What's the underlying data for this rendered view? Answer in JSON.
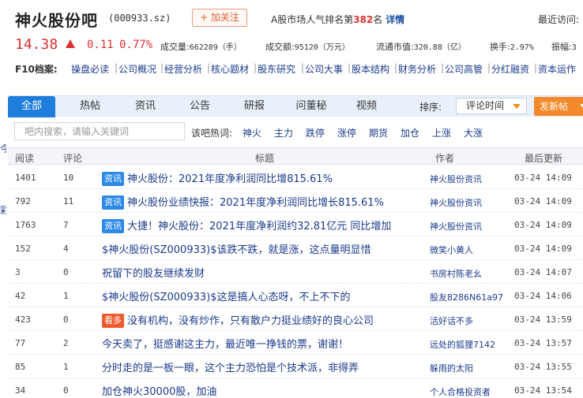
{
  "stock": {
    "name": "神火股份吧",
    "code": "(000933.sz)",
    "follow_label": "+ 加关注",
    "rank_prefix": "A股市场人气排名第",
    "rank_value": "382",
    "rank_suffix": "名",
    "rank_detail": "详情",
    "visit_label": "最近访问:"
  },
  "quote": {
    "price": "14.38",
    "change": "0.11",
    "change_pct": "0.77%",
    "volume_label": "成交量:",
    "volume_value": "662289（手）",
    "turnover_label": "成交额:",
    "turnover_value": "95120（万元）",
    "mktcap_label": "流通市值:",
    "mktcap_value": "320.88（亿）",
    "turnrate_label": "换手:",
    "turnrate_value": "2.97%",
    "amplitude_label": "振幅:",
    "amplitude_value": "3"
  },
  "f10": {
    "label": "F10档案:",
    "links": [
      "操盘必读",
      "公司概况",
      "经营分析",
      "核心题材",
      "股东研究",
      "公司大事",
      "股本结构",
      "财务分析",
      "公司高管",
      "分红融资",
      "资本运作"
    ]
  },
  "tabs": [
    "全部",
    "热帖",
    "资讯",
    "公告",
    "研报",
    "问董秘",
    "视频"
  ],
  "sort": {
    "label": "排序:",
    "value": "评论时间"
  },
  "post_button": "发新帖",
  "search": {
    "placeholder": "吧内搜索，请输入关键词"
  },
  "hot": {
    "label": "该吧热词:",
    "words": [
      "神火",
      "主力",
      "跌停",
      "涨停",
      "期货",
      "加仓",
      "上涨",
      "大涨"
    ]
  },
  "table": {
    "headers": {
      "reads": "阅读",
      "comments": "评论",
      "title": "标题",
      "author": "作者",
      "updated": "最后更新"
    },
    "rows": [
      {
        "reads": "1401",
        "comments": "10",
        "badge": "资讯",
        "title": "神火股份：2021年度净利润同比增815.61%",
        "author": "神火股份资讯",
        "time": "03-24 14:09"
      },
      {
        "reads": "792",
        "comments": "11",
        "badge": "资讯",
        "title": "神火股份业绩快报：2021年度净利润同比增长815.61%",
        "author": "神火股份资讯",
        "time": "03-24 14:09"
      },
      {
        "reads": "1763",
        "comments": "7",
        "badge": "资讯",
        "title": "大捷！神火股份：2021年度净利润约32.81亿元 同比增加",
        "author": "神火股份资讯",
        "time": "03-24 14:09"
      },
      {
        "reads": "152",
        "comments": "4",
        "badge": "",
        "title": "$神火股份(SZ000933)$该跌不跌，就是涨，这点量明显惜",
        "author": "微笑小黄人",
        "time": "03-24 14:09"
      },
      {
        "reads": "3",
        "comments": "0",
        "badge": "",
        "title": "祝留下的股友继续发财",
        "author": "书房村陈老幺",
        "time": "03-24 14:07"
      },
      {
        "reads": "42",
        "comments": "1",
        "badge": "",
        "title": "$神火股份(SZ000933)$这是搞人心态呀，不上不下的",
        "author": "股友8286N61a97",
        "time": "03-24 14:06"
      },
      {
        "reads": "423",
        "comments": "0",
        "badge": "看多",
        "title": "没有机构，没有炒作，只有散户力挺业绩好的良心公司",
        "author": "活好话不多",
        "time": "03-24 13:59"
      },
      {
        "reads": "77",
        "comments": "2",
        "badge": "",
        "title": "今天卖了，挺感谢这主力，最近唯一挣钱的票，谢谢！",
        "author": "远处的狐狸7142",
        "time": "03-24 13:57"
      },
      {
        "reads": "85",
        "comments": "1",
        "badge": "",
        "title": "分时走的是一板一眼，这个主力恐怕是个技术派，非得弄",
        "author": "躲雨的太阳",
        "time": "03-24 13:55"
      },
      {
        "reads": "34",
        "comments": "0",
        "badge": "",
        "title": "加仓神火30000股，加油",
        "author": "个人合格投资者",
        "time": "03-24 13:54"
      }
    ]
  },
  "side": {
    "top": "今",
    "bottom": "彩"
  }
}
